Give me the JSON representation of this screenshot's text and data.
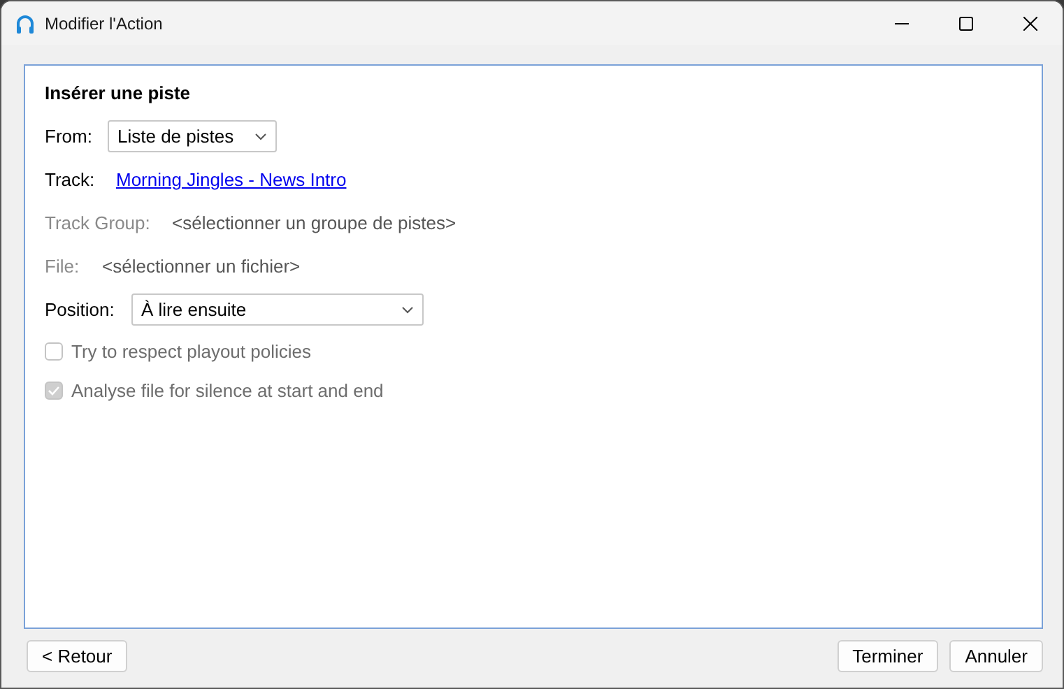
{
  "window": {
    "title": "Modifier l'Action"
  },
  "section_title": "Insérer une piste",
  "from": {
    "label": "From:",
    "value": "Liste de pistes"
  },
  "track": {
    "label": "Track:",
    "link": "Morning Jingles - News Intro"
  },
  "track_group": {
    "label": "Track Group:",
    "value": "<sélectionner un groupe de pistes>",
    "disabled": true
  },
  "file": {
    "label": "File:",
    "value": "<sélectionner un fichier>",
    "disabled": true
  },
  "position": {
    "label": "Position:",
    "value": "À lire ensuite"
  },
  "checkboxes": [
    {
      "label": "Try to respect playout policies",
      "checked": false,
      "disabled": true
    },
    {
      "label": "Analyse file for silence at start and end",
      "checked": true,
      "disabled": true
    }
  ],
  "buttons": {
    "back": "< Retour",
    "finish": "Terminer",
    "cancel": "Annuler"
  }
}
